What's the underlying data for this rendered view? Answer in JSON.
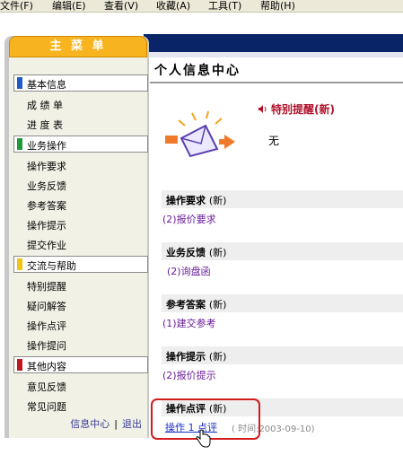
{
  "menubar": {
    "items": [
      "文件(F)",
      "编辑(E)",
      "查看(V)",
      "收藏(A)",
      "工具(T)",
      "帮助(H)"
    ]
  },
  "sidebar": {
    "title": "主 菜 单",
    "sections": [
      {
        "label": "基本信息",
        "color": "#1f5cc7",
        "items": [
          "成 绩 单",
          "进 度 表"
        ]
      },
      {
        "label": "业务操作",
        "color": "#1e9a3a",
        "items": [
          "操作要求",
          "业务反馈",
          "参考答案",
          "操作提示",
          "提交作业"
        ]
      },
      {
        "label": "交流与帮助",
        "color": "#f1c40f",
        "items": [
          "特别提醒",
          "疑问解答",
          "操作点评",
          "操作提问"
        ]
      },
      {
        "label": "其他内容",
        "color": "#c0181e",
        "items": [
          "意见反馈",
          "常见问题"
        ]
      }
    ],
    "footer": {
      "link1": "信息中心",
      "separator": "|",
      "link2": "退出"
    }
  },
  "main": {
    "title": "个人信息中心",
    "alert": {
      "title": "特别提醒(新)",
      "text": "无"
    },
    "sections": [
      {
        "title": "操作要求",
        "badge": "(新)",
        "link": "(2)报价要求"
      },
      {
        "title": "业务反馈",
        "badge": "(新)",
        "link": "(2)询盘函"
      },
      {
        "title": "参考答案",
        "badge": "(新)",
        "link": "(1)建交参考"
      },
      {
        "title": "操作提示",
        "badge": "(新)",
        "link": "(2)报价提示"
      },
      {
        "title": "操作点评",
        "badge": "(新)",
        "link": "操作 1 点评",
        "meta": "( 时间:2003-09-10)"
      }
    ]
  },
  "colors": {
    "accent_orange": "#f7b41e",
    "navy": "#0a2468",
    "alert_red": "#b0102a",
    "highlight_red": "#d21c1c"
  }
}
